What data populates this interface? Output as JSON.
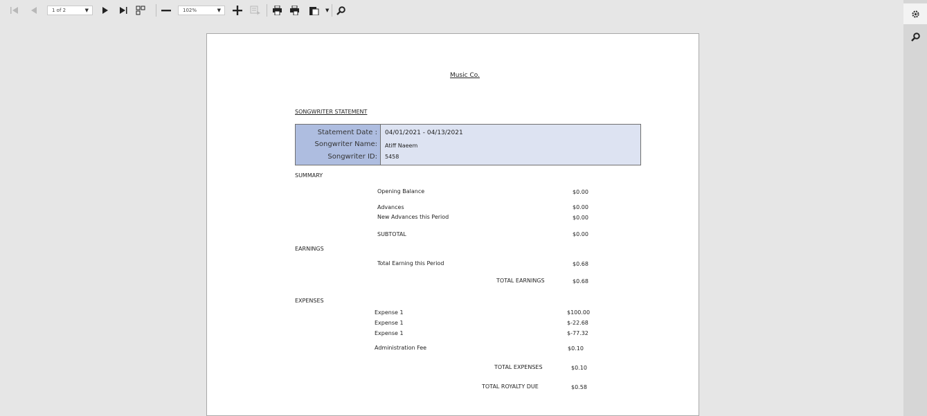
{
  "toolbar": {
    "page_select": "1 of 2",
    "zoom_select": "102%"
  },
  "report": {
    "company": "Music Co.",
    "statement_title": "SONGWRITER STATEMENT",
    "info": {
      "statement_date_label": "Statement Date :",
      "statement_date_value": "04/01/2021 - 04/13/2021",
      "songwriter_name_label": "Songwriter Name:",
      "songwriter_name_value": "Atiff Naeem",
      "songwriter_id_label": "Songwriter ID:",
      "songwriter_id_value": "5458"
    },
    "summary": {
      "heading": "SUMMARY",
      "opening_balance_label": "Opening Balance",
      "opening_balance_value": "$0.00",
      "advances_label": "Advances",
      "advances_value": "$0.00",
      "new_advances_label": "New Advances this Period",
      "new_advances_value": "$0.00",
      "subtotal_label": "SUBTOTAL",
      "subtotal_value": "$0.00"
    },
    "earnings": {
      "heading": "EARNINGS",
      "total_earning_period_label": "Total Earning this Period",
      "total_earning_period_value": "$0.68",
      "total_earnings_label": "TOTAL EARNINGS",
      "total_earnings_value": "$0.68"
    },
    "expenses": {
      "heading": "EXPENSES",
      "items": [
        {
          "label": "Expense 1",
          "value": "$100.00"
        },
        {
          "label": "Expense 1",
          "value": "$-22.68"
        },
        {
          "label": "Expense 1",
          "value": "$-77.32"
        }
      ],
      "admin_fee_label": "Administration Fee",
      "admin_fee_value": "$0.10",
      "total_expenses_label": "TOTAL EXPENSES",
      "total_expenses_value": "$0.10",
      "total_royalty_label": "TOTAL ROYALTY DUE",
      "total_royalty_value": "$0.58"
    }
  }
}
